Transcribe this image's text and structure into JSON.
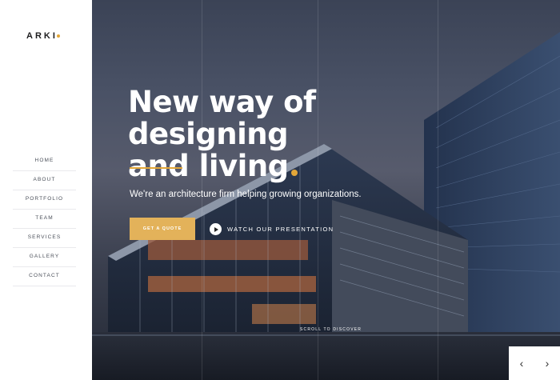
{
  "logo": {
    "text": "ARKI",
    "dot_color": "#e3a739"
  },
  "nav": {
    "items": [
      {
        "label": "HOME"
      },
      {
        "label": "ABOUT"
      },
      {
        "label": "PORTFOLIO"
      },
      {
        "label": "TEAM"
      },
      {
        "label": "SERVICES"
      },
      {
        "label": "GALLERY"
      },
      {
        "label": "CONTACT"
      }
    ]
  },
  "hero": {
    "title_line1": "New way of designing",
    "title_line2": "and living",
    "subtitle": "We're an architecture firm helping growing organizations.",
    "quote_button": "GET A QUOTE",
    "watch_label": "WATCH OUR PRESENTATION",
    "scroll_label": "SCROLL TO DISCOVER",
    "accent_color": "#e3a739",
    "background_image": "glass office building at dusk"
  },
  "slider": {
    "prev_icon": "chevron-left-icon",
    "next_icon": "chevron-right-icon",
    "prev": "‹",
    "next": "›"
  }
}
